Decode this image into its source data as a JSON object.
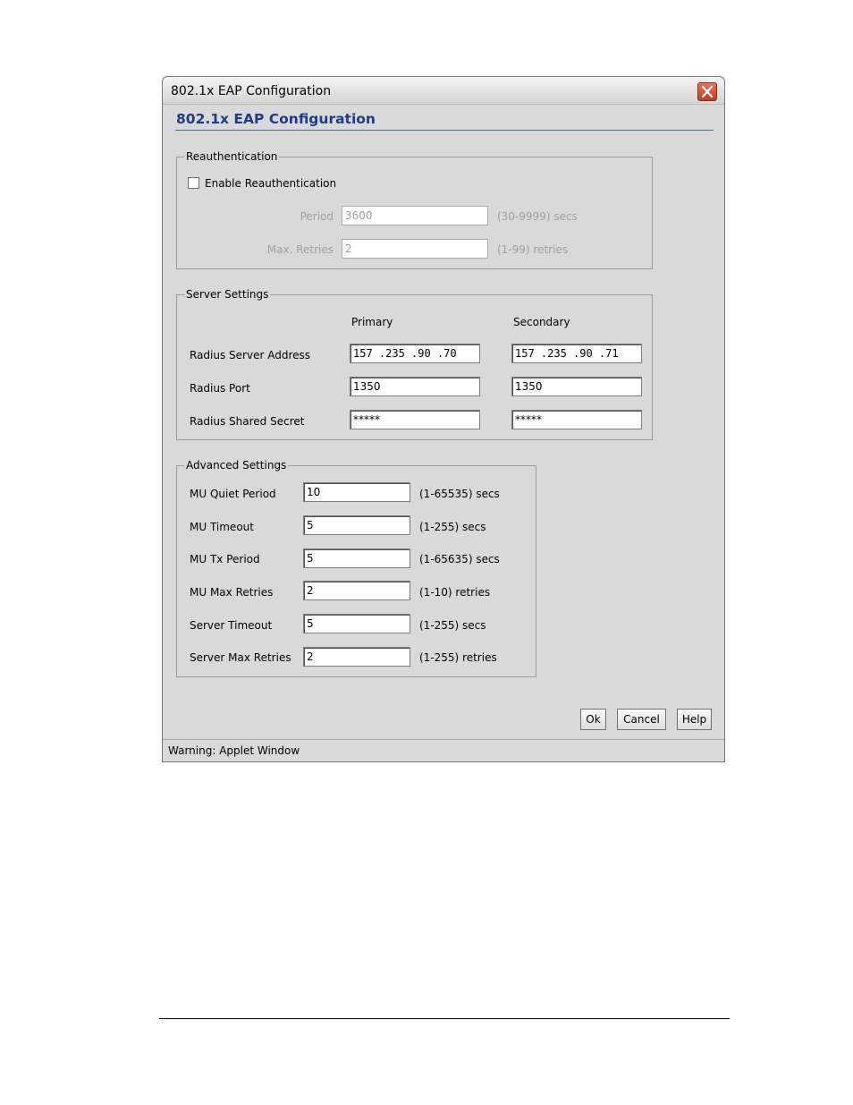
{
  "window": {
    "title": "802.1x EAP Configuration",
    "close_icon": "close-icon"
  },
  "header": {
    "title": "802.1x EAP Configuration"
  },
  "reauth": {
    "legend": "Reauthentication",
    "enable_label": "Enable Reauthentication",
    "enable_checked": false,
    "period_label": "Period",
    "period_value": "3600",
    "period_hint": "(30-9999) secs",
    "retries_label": "Max. Retries",
    "retries_value": "2",
    "retries_hint": "(1-99) retries"
  },
  "server": {
    "legend": "Server Settings",
    "primary_header": "Primary",
    "secondary_header": "Secondary",
    "address_label": "Radius Server Address",
    "address_primary": "157 .235 .90  .70",
    "address_secondary": "157 .235 .90  .71",
    "port_label": "Radius Port",
    "port_primary": "1350",
    "port_secondary": "1350",
    "secret_label": "Radius Shared Secret",
    "secret_primary": "*****",
    "secret_secondary": "*****"
  },
  "advanced": {
    "legend": "Advanced Settings",
    "rows": [
      {
        "label": "MU Quiet Period",
        "value": "10",
        "hint": "(1-65535) secs"
      },
      {
        "label": "MU Timeout",
        "value": "5",
        "hint": "(1-255) secs"
      },
      {
        "label": "MU Tx Period",
        "value": "5",
        "hint": "(1-65635) secs"
      },
      {
        "label": "MU Max Retries",
        "value": "2",
        "hint": "(1-10) retries"
      },
      {
        "label": "Server Timeout",
        "value": "5",
        "hint": "(1-255) secs"
      },
      {
        "label": "Server Max Retries",
        "value": "2",
        "hint": "(1-255) retries"
      }
    ]
  },
  "buttons": {
    "ok": "Ok",
    "cancel": "Cancel",
    "help": "Help"
  },
  "status": {
    "text": "Warning: Applet Window"
  },
  "colors": {
    "header_title": "#1e3c8c",
    "dialog_bg": "#d9d9d9",
    "close_button": "#c33a1e"
  }
}
